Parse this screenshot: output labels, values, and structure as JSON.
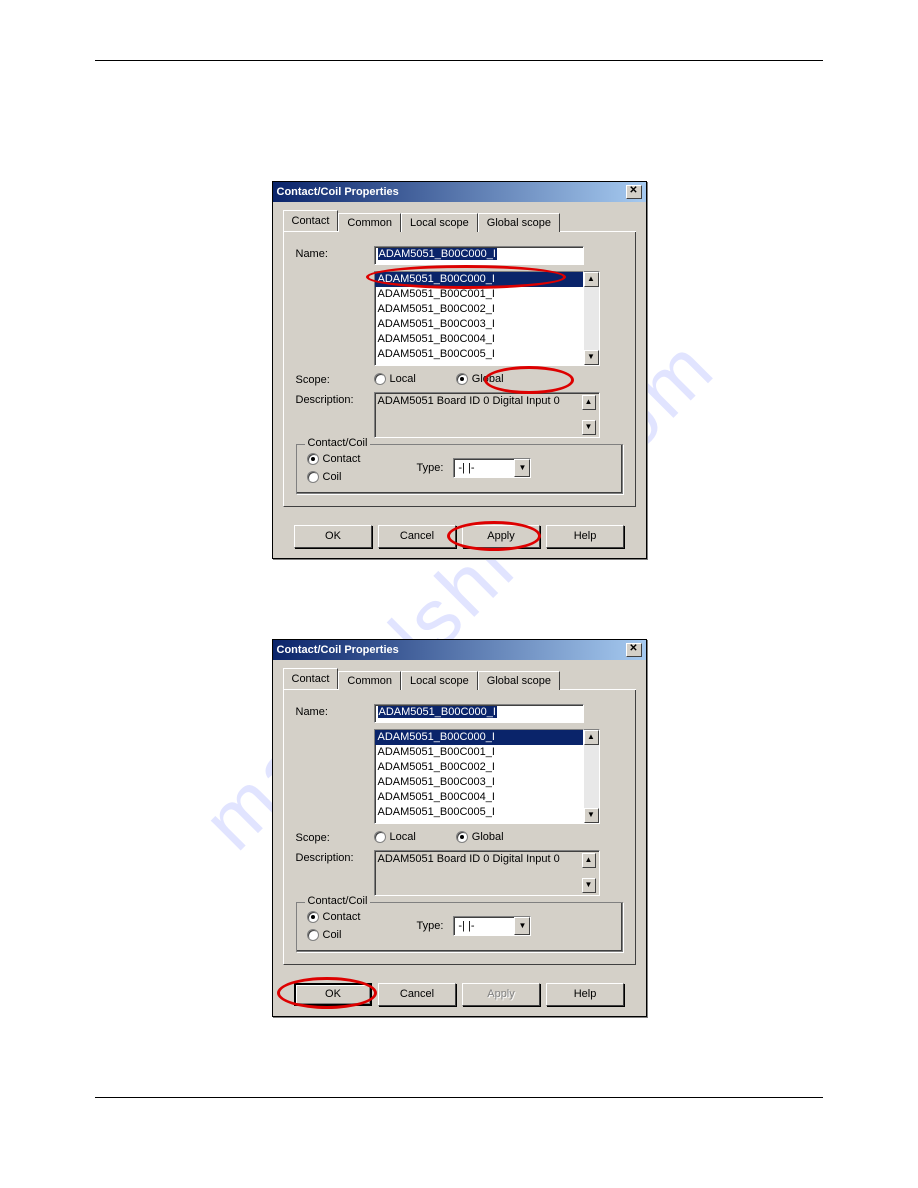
{
  "watermark": "manualshive.com",
  "dialog1": {
    "title": "Contact/Coil Properties",
    "tabs": [
      "Contact",
      "Common",
      "Local scope",
      "Global scope"
    ],
    "labels": {
      "name": "Name:",
      "scope": "Scope:",
      "description": "Description:",
      "type": "Type:"
    },
    "name_value": "ADAM5051_B00C000_I",
    "list": [
      "ADAM5051_B00C000_I",
      "ADAM5051_B00C001_I",
      "ADAM5051_B00C002_I",
      "ADAM5051_B00C003_I",
      "ADAM5051_B00C004_I",
      "ADAM5051_B00C005_I"
    ],
    "scope": {
      "local": "Local",
      "global": "Global",
      "selected": "global"
    },
    "description_value": "ADAM5051 Board ID 0 Digital Input 0",
    "group_legend": "Contact/Coil",
    "group": {
      "contact": "Contact",
      "coil": "Coil",
      "selected": "contact"
    },
    "type_value": "-| |-",
    "buttons": {
      "ok": "OK",
      "cancel": "Cancel",
      "apply": "Apply",
      "help": "Help"
    },
    "apply_disabled": false
  },
  "dialog2": {
    "title": "Contact/Coil Properties",
    "tabs": [
      "Contact",
      "Common",
      "Local scope",
      "Global scope"
    ],
    "labels": {
      "name": "Name:",
      "scope": "Scope:",
      "description": "Description:",
      "type": "Type:"
    },
    "name_value": "ADAM5051_B00C000_I",
    "list": [
      "ADAM5051_B00C000_I",
      "ADAM5051_B00C001_I",
      "ADAM5051_B00C002_I",
      "ADAM5051_B00C003_I",
      "ADAM5051_B00C004_I",
      "ADAM5051_B00C005_I"
    ],
    "scope": {
      "local": "Local",
      "global": "Global",
      "selected": "global"
    },
    "description_value": "ADAM5051 Board ID 0 Digital Input 0",
    "group_legend": "Contact/Coil",
    "group": {
      "contact": "Contact",
      "coil": "Coil",
      "selected": "contact"
    },
    "type_value": "-| |-",
    "buttons": {
      "ok": "OK",
      "cancel": "Cancel",
      "apply": "Apply",
      "help": "Help"
    },
    "apply_disabled": true
  }
}
